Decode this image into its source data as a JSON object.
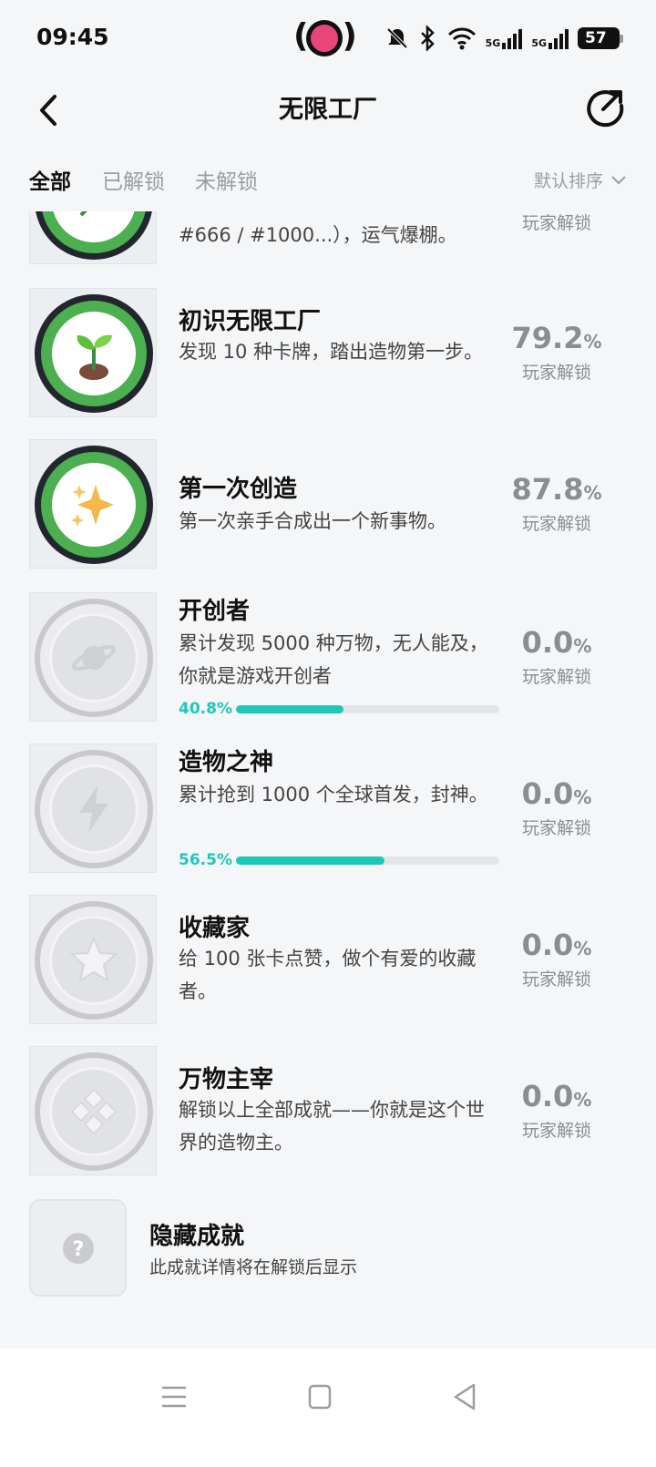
{
  "status_bar": {
    "time": "09:45",
    "battery": "57",
    "network_1": "5G",
    "network_2": "5G"
  },
  "header": {
    "title": "无限工厂"
  },
  "tabs": [
    {
      "label": "全部",
      "active": true
    },
    {
      "label": "已解锁",
      "active": false
    },
    {
      "label": "未解锁",
      "active": false
    }
  ],
  "sort": {
    "label": "默认排序"
  },
  "achievements": [
    {
      "title": "",
      "desc": "#666 / #1000...），运气爆棚。",
      "percent": "",
      "percent_label": "玩家解锁",
      "unlocked": true,
      "icon": "leaf-icon"
    },
    {
      "title": "初识无限工厂",
      "desc": "发现 10 种卡牌，踏出造物第一步。",
      "percent": "79.2",
      "percent_symbol": "%",
      "percent_label": "玩家解锁",
      "unlocked": true,
      "icon": "sprout-icon"
    },
    {
      "title": "第一次创造",
      "desc": "第一次亲手合成出一个新事物。",
      "percent": "87.8",
      "percent_symbol": "%",
      "percent_label": "玩家解锁",
      "unlocked": true,
      "icon": "sparkles-icon"
    },
    {
      "title": "开创者",
      "desc": "累计发现 5000 种万物，无人能及，你就是游戏开创者",
      "percent": "0.0",
      "percent_symbol": "%",
      "percent_label": "玩家解锁",
      "unlocked": false,
      "icon": "planet-icon",
      "progress_label": "40.8%",
      "progress": 0.408
    },
    {
      "title": "造物之神",
      "desc": "累计抢到 1000 个全球首发，封神。",
      "percent": "0.0",
      "percent_symbol": "%",
      "percent_label": "玩家解锁",
      "unlocked": false,
      "icon": "lightning-icon",
      "progress_label": "56.5%",
      "progress": 0.565
    },
    {
      "title": "收藏家",
      "desc": "给 100 张卡点赞，做个有爱的收藏者。",
      "percent": "0.0",
      "percent_symbol": "%",
      "percent_label": "玩家解锁",
      "unlocked": false,
      "icon": "star-icon"
    },
    {
      "title": "万物主宰",
      "desc": "解锁以上全部成就——你就是这个世界的造物主。",
      "percent": "0.0",
      "percent_symbol": "%",
      "percent_label": "玩家解锁",
      "unlocked": false,
      "icon": "diamond-grid-icon"
    }
  ],
  "hidden_achievement": {
    "title": "隐藏成就",
    "desc": "此成就详情将在解锁后显示",
    "icon": "question-icon"
  },
  "colors": {
    "accent": "#1ec8b8",
    "unlocked_ring": "#4caf50",
    "muted_text": "#8a8d93"
  }
}
